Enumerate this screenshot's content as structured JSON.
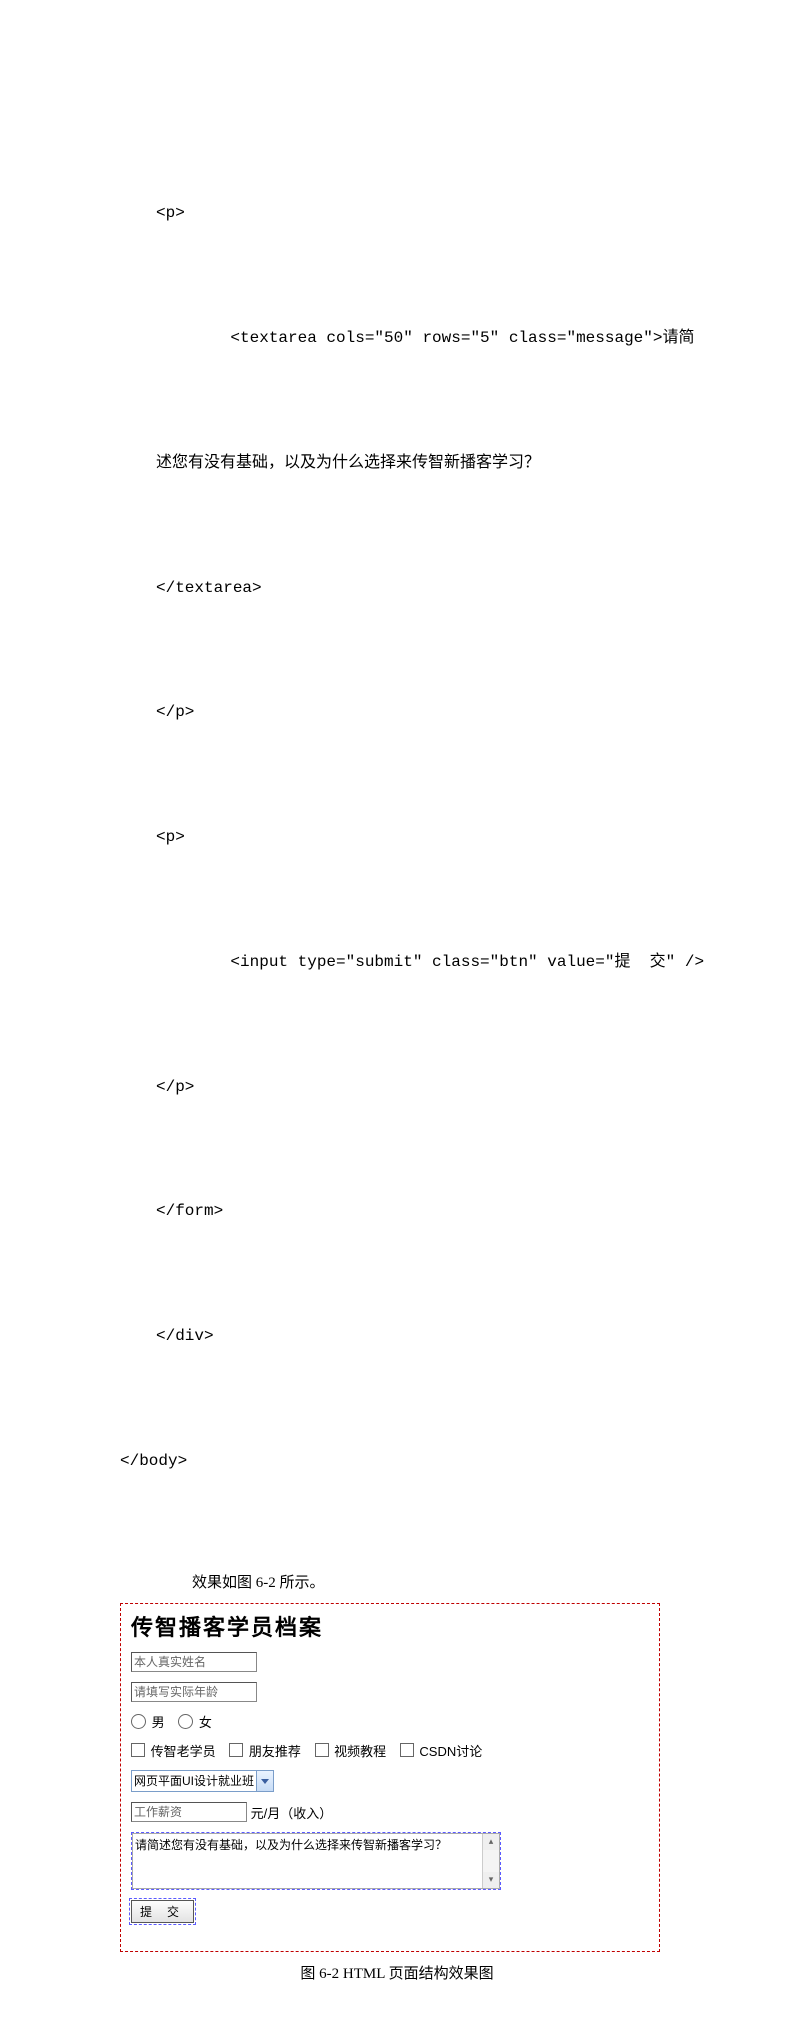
{
  "code": {
    "l1": "<p>",
    "l2": "    <textarea cols=\"50\" rows=\"5\" class=\"message\">请简",
    "l3": "述您有没有基础，以及为什么选择来传智新播客学习？",
    "l4": "</textarea>",
    "l5": "</p>",
    "l6": "<p>",
    "l7": "    <input type=\"submit\" class=\"btn\" value=\"提  交\" />",
    "l8": "</p>",
    "l9": "</form>",
    "l10": "</div>",
    "l11": "</body>"
  },
  "result_intro": "效果如图 6-2 所示。",
  "form": {
    "title": "传智播客学员档案",
    "name_placeholder": "本人真实姓名",
    "age_placeholder": "请填写实际年龄",
    "gender_male": "男",
    "gender_female": "女",
    "chk1": "传智老学员",
    "chk2": "朋友推荐",
    "chk3": "视频教程",
    "chk4": "CSDN讨论",
    "select_value": "网页平面UI设计就业班",
    "salary_placeholder": "工作薪资",
    "salary_suffix": "元/月（收入）",
    "textarea_value": "请简述您有没有基础，以及为什么选择来传智新播客学习？",
    "submit_label": "提 交"
  },
  "caption": "图 6-2 HTML 页面结构效果图"
}
